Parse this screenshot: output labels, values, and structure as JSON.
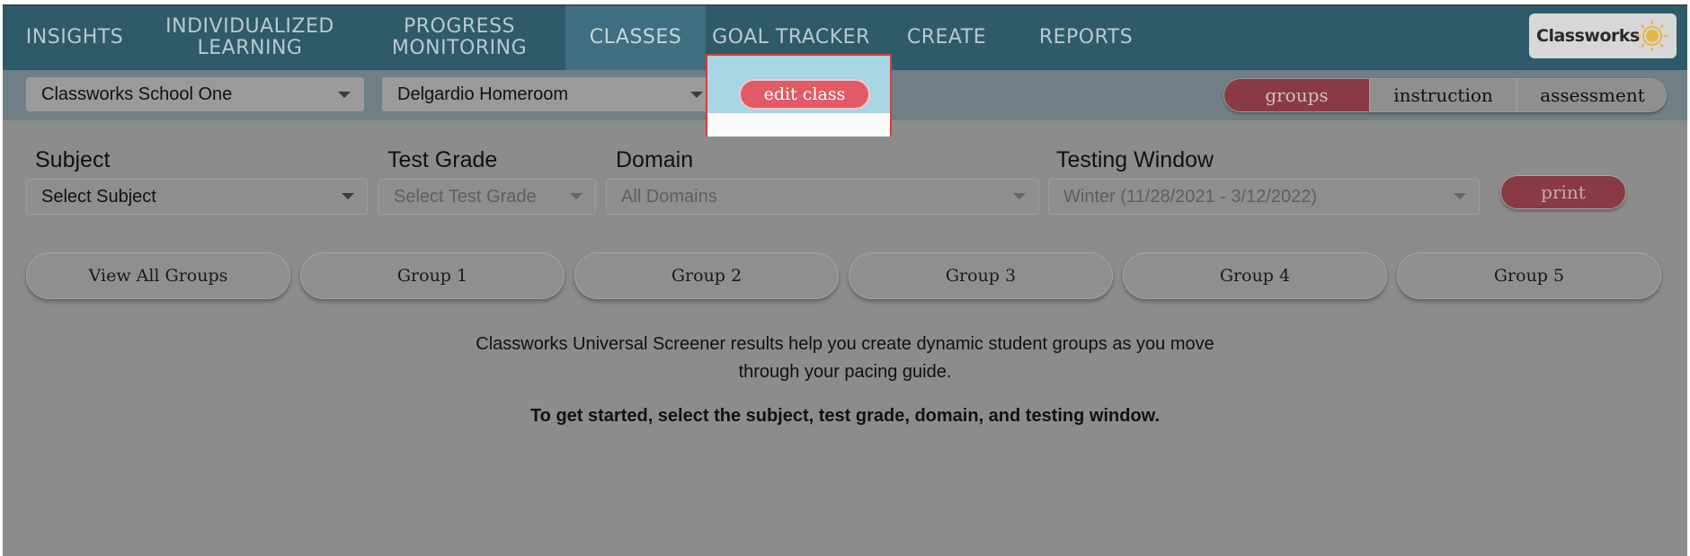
{
  "nav": {
    "items": [
      {
        "label": "INSIGHTS"
      },
      {
        "label_line1": "INDIVIDUALIZED",
        "label_line2": "LEARNING"
      },
      {
        "label_line1": "PROGRESS",
        "label_line2": "MONITORING"
      },
      {
        "label": "CLASSES",
        "active": true
      },
      {
        "label": "GOAL TRACKER"
      },
      {
        "label": "CREATE"
      },
      {
        "label": "REPORTS"
      }
    ],
    "brand": "Classworks",
    "brand_icon": "sun-logo-icon"
  },
  "subbar": {
    "school_select": "Classworks School One",
    "class_select": "Delgardio Homeroom",
    "edit_class_label": "edit class",
    "view_toggle": [
      "groups",
      "instruction",
      "assessment"
    ],
    "view_selected": "groups"
  },
  "filters": {
    "subject_label": "Subject",
    "subject_value": "Select Subject",
    "grade_label": "Test Grade",
    "grade_value": "Select Test Grade",
    "domain_label": "Domain",
    "domain_value": "All Domains",
    "window_label": "Testing Window",
    "window_value": "Winter (11/28/2021 - 3/12/2022)",
    "print_label": "print"
  },
  "groups": [
    "View All Groups",
    "Group 1",
    "Group 2",
    "Group 3",
    "Group 4",
    "Group 5"
  ],
  "info": {
    "line1": "Classworks Universal Screener results help you create dynamic student groups as you move",
    "line2": "through your pacing guide.",
    "bold": "To get started, select the subject, test grade, domain, and testing window."
  },
  "colors": {
    "nav_bg": "#2f5a6a",
    "overlay_bg": "#8c8c8c",
    "accent_red": "#e25a66",
    "highlight_border": "#d43f3a"
  }
}
